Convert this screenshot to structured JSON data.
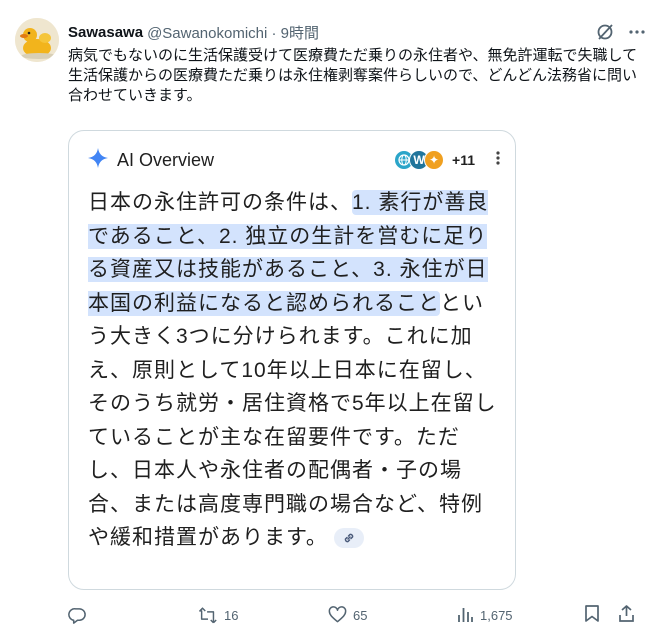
{
  "post": {
    "display_name": "Sawasawa",
    "handle_time": "@Sawanokomichi · 9時間",
    "text": "病気でもないのに生活保護受けて医療費ただ乗りの永住者や、無免許運転で失職して生活保護からの医療費ただ乗りは永住権剥奪案件らしいので、どんどん法務省に問い合わせていきます。"
  },
  "ai_overview": {
    "title": "AI Overview",
    "source_count": "+11",
    "text_before": "日本の永住許可の条件は、",
    "text_highlight": "1. 素行が善良であること、2. 独立の生計を営むに足りる資産又は技能があること、3. 永住が日本国の利益になると認められること",
    "text_after": "という大きく3つに分けられます。これに加え、原則として10年以上日本に在留し、そのうち就労・居住資格で5年以上在留していることが主な在留要件です。ただし、日本人や永住者の配偶者・子の場合、または高度専門職の場合など、特例や緩和措置があります。"
  },
  "actions": {
    "reply_count": "",
    "repost_count": "16",
    "like_count": "65",
    "view_count": "1,675"
  },
  "colors": {
    "highlight": "#d3e3fd",
    "secondary_text": "#536471",
    "gemini_blue": "#4285f4"
  }
}
